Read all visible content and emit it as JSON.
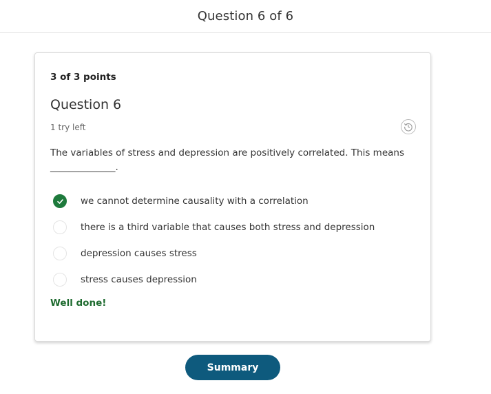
{
  "header": {
    "title": "Question 6 of 6"
  },
  "question": {
    "points": "3 of 3 points",
    "title": "Question 6",
    "tries_left": "1 try left",
    "stem": "The variables of stress and depression are positively correlated. This means ______________.",
    "history_icon": "history-icon",
    "options": [
      {
        "label": "we cannot determine causality with a correlation",
        "selected": true,
        "correct": true
      },
      {
        "label": "there is a third variable that causes both stress and depression",
        "selected": false
      },
      {
        "label": "depression causes stress",
        "selected": false
      },
      {
        "label": "stress causes depression",
        "selected": false
      }
    ],
    "feedback": "Well done!"
  },
  "footer": {
    "summary_label": "Summary"
  },
  "colors": {
    "correct_green": "#1e7a3c",
    "feedback_green": "#1e6b2f",
    "primary_button": "#0e5a7d"
  }
}
